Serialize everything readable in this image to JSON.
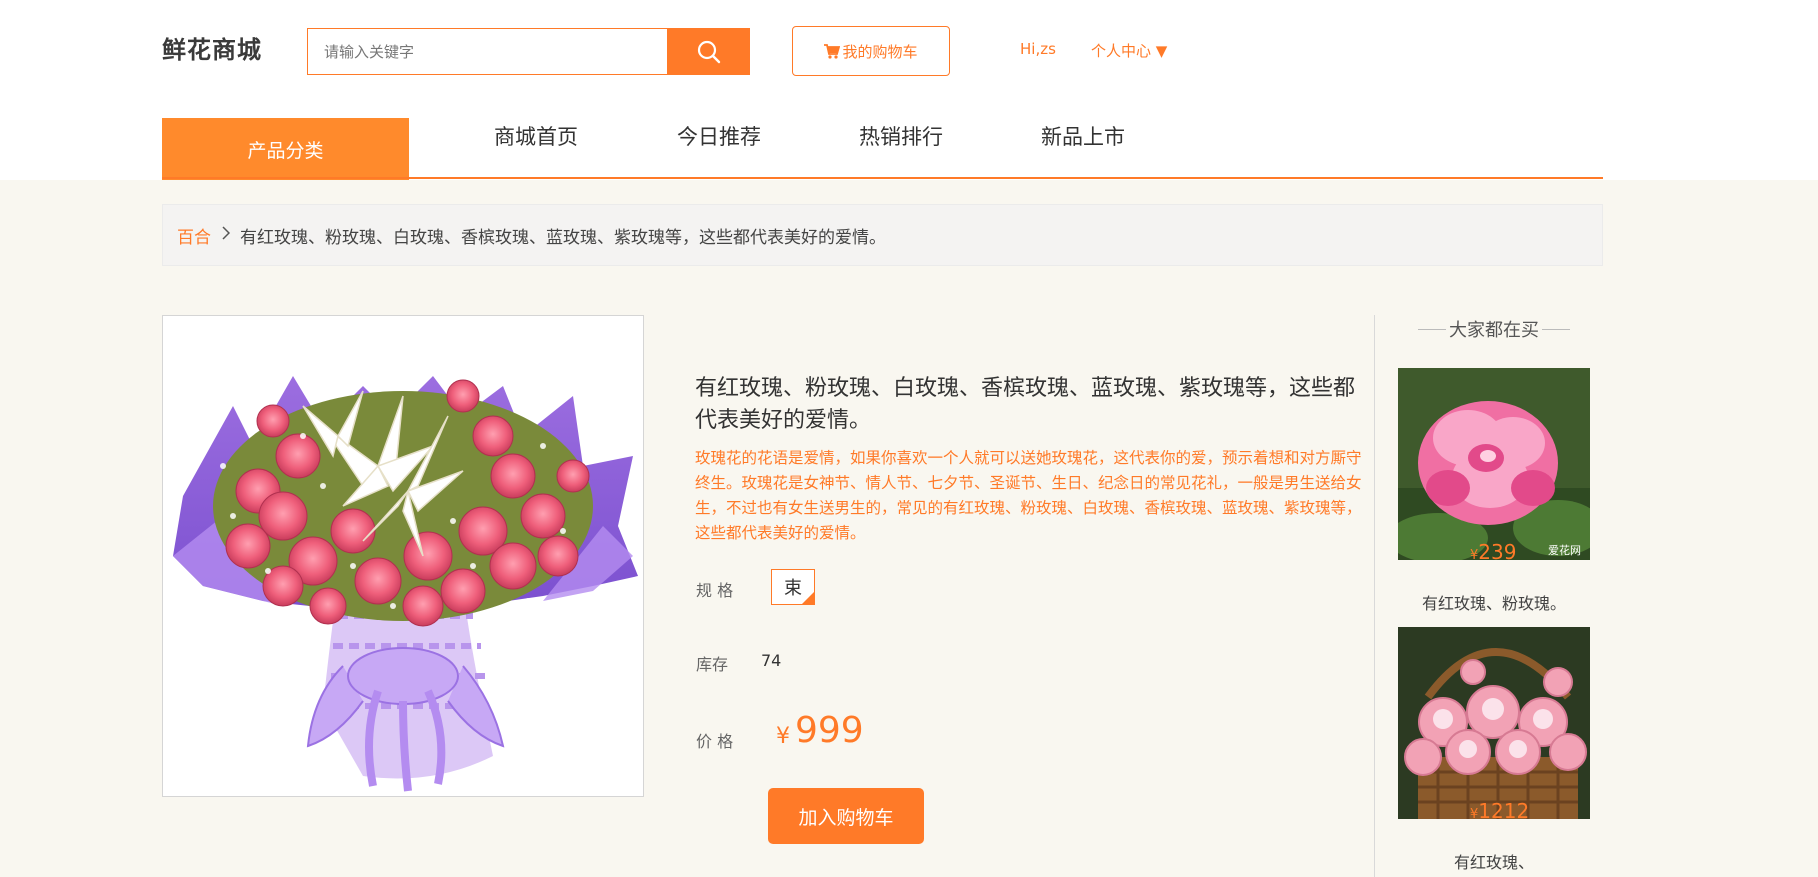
{
  "header": {
    "logo": "鲜花商城",
    "search_placeholder": "请输入关键字",
    "cart_label": "我的购物车",
    "greeting": "Hi,zs",
    "user_center": "个人中心 ▼"
  },
  "nav": {
    "category": "产品分类",
    "items": [
      "商城首页",
      "今日推荐",
      "热销排行",
      "新品上市"
    ]
  },
  "breadcrumb": {
    "category": "百合",
    "current": "有红玫瑰、粉玫瑰、白玫瑰、香槟玫瑰、蓝玫瑰、紫玫瑰等，这些都代表美好的爱情。"
  },
  "product": {
    "title": "有红玫瑰、粉玫瑰、白玫瑰、香槟玫瑰、蓝玫瑰、紫玫瑰等，这些都代表美好的爱情。",
    "description": "玫瑰花的花语是爱情，如果你喜欢一个人就可以送她玫瑰花，这代表你的爱，预示着想和对方厮守终生。玫瑰花是女神节、情人节、七夕节、圣诞节、生日、纪念日的常见花礼，一般是男生送给女生，不过也有女生送男生的，常见的有红玫瑰、粉玫瑰、白玫瑰、香槟玫瑰、蓝玫瑰、紫玫瑰等，这些都代表美好的爱情。",
    "spec_label": "规 格",
    "spec_value": "束",
    "stock_label": "库存",
    "stock_value": "74",
    "price_label": "价 格",
    "price_symbol": "¥",
    "price_value": "999",
    "add_to_cart": "加入购物车"
  },
  "popular": {
    "title": "大家都在买",
    "items": [
      {
        "price_symbol": "¥",
        "price": "239",
        "name": "有红玫瑰、粉玫瑰。",
        "watermark": "爱花网"
      },
      {
        "price_symbol": "¥",
        "price": "1212",
        "name": "有红玫瑰、"
      }
    ]
  },
  "colors": {
    "accent": "#ff7a28",
    "nav_category_bg": "#ff8a2c",
    "page_bg": "#f9f7f0"
  }
}
